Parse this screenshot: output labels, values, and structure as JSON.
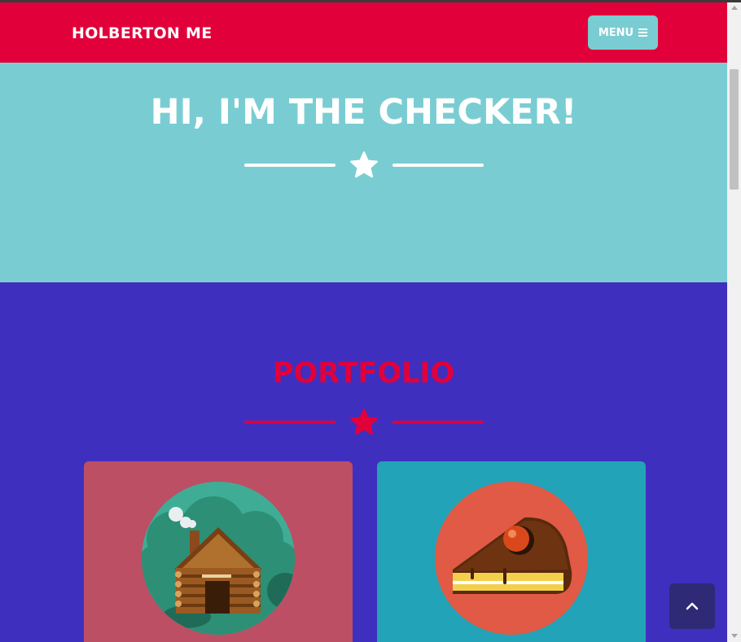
{
  "navbar": {
    "brand": "HOLBERTON ME",
    "menu_label": "MENU",
    "menu_icon": "hamburger-icon"
  },
  "hero": {
    "title": "HI, I'M THE CHECKER!",
    "divider_icon": "star-icon"
  },
  "portfolio": {
    "title": "PORTFOLIO",
    "divider_icon": "star-icon",
    "items": [
      {
        "icon": "cabin-icon"
      },
      {
        "icon": "cake-icon"
      }
    ]
  },
  "back_to_top": {
    "icon": "chevron-up-icon"
  },
  "colors": {
    "navbar": "#e2003a",
    "menu_button": "#79cdd2",
    "hero_bg": "#79cdd2",
    "portfolio_bg": "#3f2fbf",
    "portfolio_title": "#e2003a",
    "card_cabin": "#bc4f64",
    "card_cake": "#22a3b7",
    "back_to_top": "#2e2a75"
  }
}
